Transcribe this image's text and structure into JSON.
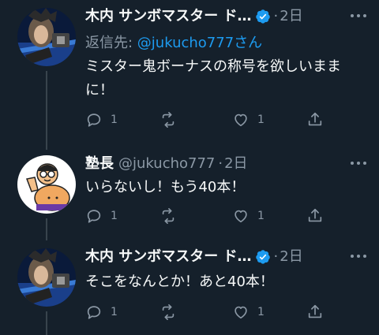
{
  "tweets": [
    {
      "name": "木内 サンボマスター ド…",
      "handle": "",
      "verified": true,
      "time": "2日",
      "reply_prefix": "返信先: ",
      "reply_handle": "@jukucho777",
      "reply_suffix": "さん",
      "text": "ミスター鬼ボーナスの称号を欲しいままに！",
      "counts": {
        "reply": "1",
        "retweet": "",
        "like": "1",
        "share": ""
      },
      "avatar_icon": "avatar-icon"
    },
    {
      "name": "塾長",
      "handle": "@jukucho777",
      "verified": false,
      "time": "2日",
      "text": "いらないし！もう40本！",
      "counts": {
        "reply": "1",
        "retweet": "",
        "like": "1",
        "share": ""
      },
      "avatar_icon": "avatar-icon"
    },
    {
      "name": "木内 サンボマスター ド…",
      "handle": "",
      "verified": true,
      "time": "2日",
      "text": "そこをなんとか！あと40本！",
      "counts": {
        "reply": "1",
        "retweet": "",
        "like": "1",
        "share": ""
      },
      "avatar_icon": "avatar-icon"
    }
  ],
  "colors": {
    "background": "#15202b",
    "text": "#f7f9f9",
    "muted": "#8b98a5",
    "link": "#1d9bf0",
    "thread_line": "#38444d"
  }
}
